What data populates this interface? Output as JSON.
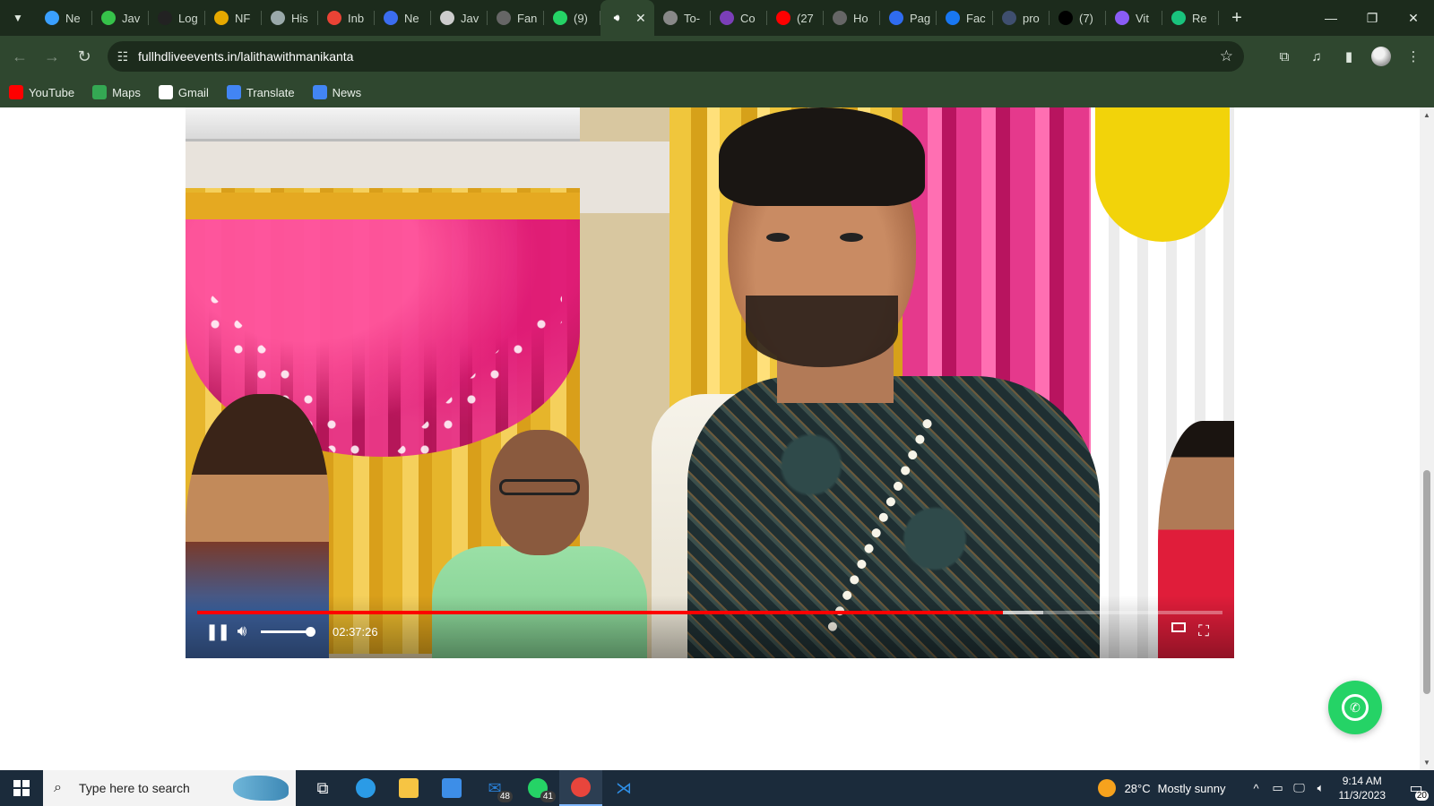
{
  "browser": {
    "tabs": [
      {
        "title": "Ne",
        "icon": "globe-icon",
        "color": "#3aa0ff"
      },
      {
        "title": "Jav",
        "icon": "w-icon",
        "color": "#36c24a"
      },
      {
        "title": "Log",
        "icon": "grid-icon",
        "color": "#222222"
      },
      {
        "title": "NF",
        "icon": "coin-icon",
        "color": "#e6a800"
      },
      {
        "title": "His",
        "icon": "history-icon",
        "color": "#9aa9aa"
      },
      {
        "title": "Inb",
        "icon": "gmail-icon",
        "color": "#ea4335"
      },
      {
        "title": "Ne",
        "icon": "iir-icon",
        "color": "#3b6df0"
      },
      {
        "title": "Jav",
        "icon": "globe-icon",
        "color": "#cccccc"
      },
      {
        "title": "Fan",
        "icon": "circle-icon",
        "color": "#666666"
      },
      {
        "title": "(9)",
        "icon": "whatsapp-icon",
        "color": "#25d366"
      },
      {
        "title": "",
        "icon": "speaker-icon",
        "color": "#ffffff",
        "active": true
      },
      {
        "title": "To-",
        "icon": "globe-icon",
        "color": "#888888"
      },
      {
        "title": "Co",
        "icon": "disc-icon",
        "color": "#7b3fb8"
      },
      {
        "title": "(27",
        "icon": "youtube-icon",
        "color": "#ff0000"
      },
      {
        "title": "Ho",
        "icon": "x-icon",
        "color": "#666666"
      },
      {
        "title": "Pag",
        "icon": "circle-icon",
        "color": "#2f6cf0"
      },
      {
        "title": "Fac",
        "icon": "facebook-icon",
        "color": "#1877f2"
      },
      {
        "title": "pro",
        "icon": "circle-icon",
        "color": "#3f4f6f"
      },
      {
        "title": "(7)",
        "icon": "x-icon",
        "color": "#000000"
      },
      {
        "title": "Vit",
        "icon": "vite-icon",
        "color": "#8a5cf6"
      },
      {
        "title": "Re",
        "icon": "chatgpt-icon",
        "color": "#19c37d"
      }
    ],
    "new_tab": "+",
    "window_controls": {
      "minimize": "—",
      "restore": "❐",
      "close": "✕"
    },
    "url": "fullhdliveevents.in/lalithawithmanikanta",
    "bookmarks": [
      {
        "label": "YouTube",
        "icon": "youtube-icon",
        "color": "#ff0000"
      },
      {
        "label": "Maps",
        "icon": "maps-icon",
        "color": "#34a853"
      },
      {
        "label": "Gmail",
        "icon": "google-icon",
        "color": "#ffffff"
      },
      {
        "label": "Translate",
        "icon": "translate-icon",
        "color": "#4285f4"
      },
      {
        "label": "News",
        "icon": "news-icon",
        "color": "#4285f4"
      }
    ]
  },
  "video": {
    "current_time": "02:37:26",
    "played_fraction": 0.786,
    "buffered_fraction": 0.825,
    "volume_fraction": 1.0
  },
  "taskbar": {
    "search_placeholder": "Type here to search",
    "apps": [
      {
        "name": "task-view",
        "badge": ""
      },
      {
        "name": "edge",
        "badge": ""
      },
      {
        "name": "file-explorer",
        "badge": ""
      },
      {
        "name": "microsoft-store",
        "badge": ""
      },
      {
        "name": "mail",
        "badge": "48"
      },
      {
        "name": "whatsapp",
        "badge": "41"
      },
      {
        "name": "chrome",
        "badge": "",
        "active": true
      },
      {
        "name": "vscode",
        "badge": ""
      }
    ],
    "weather": {
      "temp": "28°C",
      "condition": "Mostly sunny"
    },
    "time": "9:14 AM",
    "date": "11/3/2023",
    "notifications": "20"
  },
  "colors": {
    "chrome_dark": "#1c2b1c",
    "chrome_toolbar": "#2f472f",
    "progress_played": "#ff0000",
    "whatsapp_green": "#25d366",
    "taskbar": "#1b2b3b"
  }
}
